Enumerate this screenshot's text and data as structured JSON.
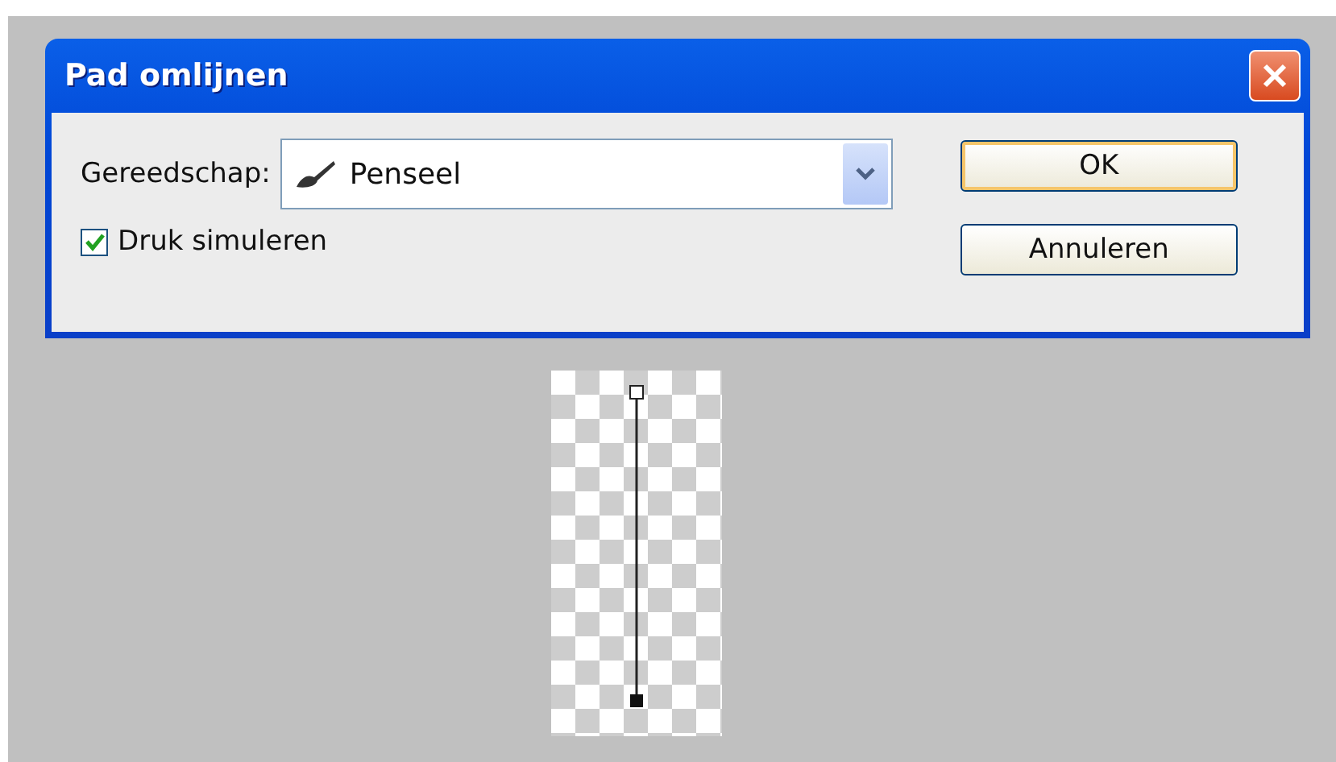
{
  "window": {
    "title": "Pad omlijnen"
  },
  "tool": {
    "label": "Gereedschap:",
    "value": "Penseel"
  },
  "simulate_pressure": {
    "label": "Druk simuleren",
    "checked": true
  },
  "buttons": [
    {
      "label": "OK",
      "kind": "default"
    },
    {
      "label": "Annuleren",
      "kind": "normal"
    }
  ]
}
